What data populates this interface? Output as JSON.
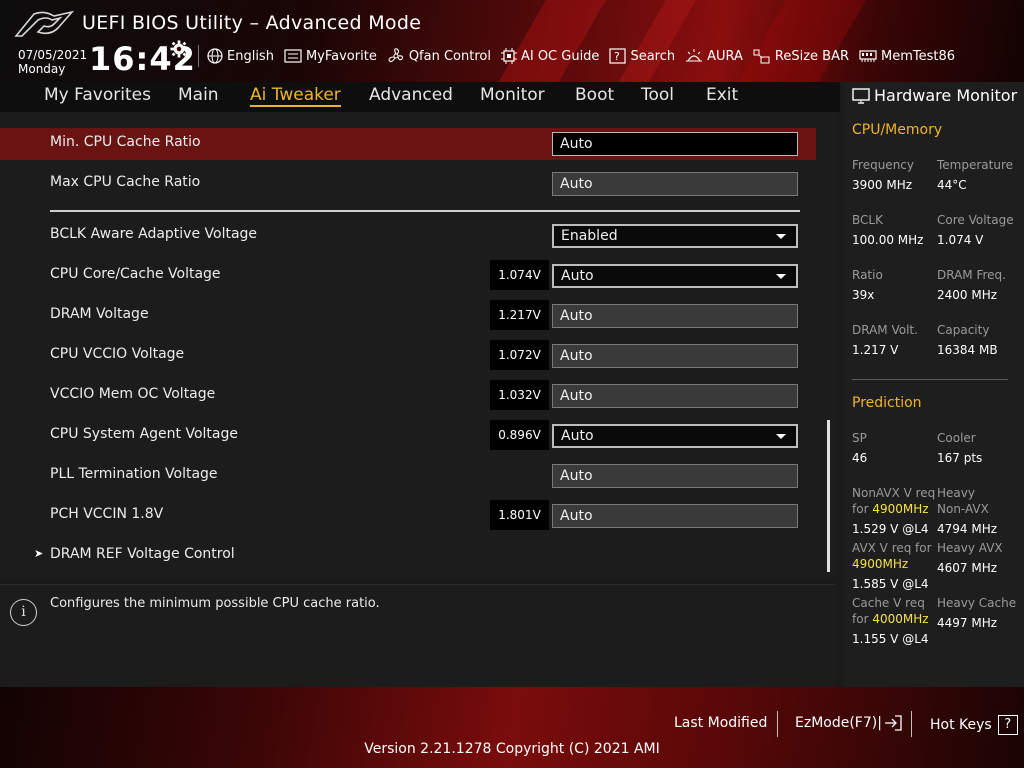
{
  "header": {
    "title": "UEFI BIOS Utility – Advanced Mode",
    "date": "07/05/2021",
    "day": "Monday",
    "time": "16:42",
    "toolbar": [
      {
        "label": "English",
        "icon": "globe-icon"
      },
      {
        "label": "MyFavorite",
        "icon": "favorite-icon"
      },
      {
        "label": "Qfan Control",
        "icon": "fan-icon"
      },
      {
        "label": "AI OC Guide",
        "icon": "ai-oc-icon"
      },
      {
        "label": "Search",
        "icon": "search-help-icon"
      },
      {
        "label": "AURA",
        "icon": "aura-icon"
      },
      {
        "label": "ReSize BAR",
        "icon": "resize-bar-icon"
      },
      {
        "label": "MemTest86",
        "icon": "memtest-icon"
      }
    ]
  },
  "menu": {
    "tabs": [
      "My Favorites",
      "Main",
      "Ai Tweaker",
      "Advanced",
      "Monitor",
      "Boot",
      "Tool",
      "Exit"
    ],
    "active": "Ai Tweaker"
  },
  "settings": [
    {
      "label": "Min. CPU Cache Ratio",
      "value": "Auto",
      "voltage": "",
      "selected": true,
      "dropdown": false
    },
    {
      "label": "Max CPU Cache Ratio",
      "value": "Auto",
      "voltage": "",
      "selected": false,
      "dropdown": false
    },
    {
      "label": "BCLK Aware Adaptive Voltage",
      "value": "Enabled",
      "voltage": "",
      "selected": false,
      "dropdown": true
    },
    {
      "label": "CPU Core/Cache Voltage",
      "value": "Auto",
      "voltage": "1.074V",
      "selected": false,
      "dropdown": true
    },
    {
      "label": "DRAM Voltage",
      "value": "Auto",
      "voltage": "1.217V",
      "selected": false,
      "dropdown": false
    },
    {
      "label": "CPU VCCIO Voltage",
      "value": "Auto",
      "voltage": "1.072V",
      "selected": false,
      "dropdown": false
    },
    {
      "label": "VCCIO Mem OC Voltage",
      "value": "Auto",
      "voltage": "1.032V",
      "selected": false,
      "dropdown": false
    },
    {
      "label": "CPU System Agent Voltage",
      "value": "Auto",
      "voltage": "0.896V",
      "selected": false,
      "dropdown": true
    },
    {
      "label": "PLL Termination Voltage",
      "value": "Auto",
      "voltage": "",
      "selected": false,
      "dropdown": false
    },
    {
      "label": "PCH VCCIN 1.8V",
      "value": "Auto",
      "voltage": "1.801V",
      "selected": false,
      "dropdown": false
    }
  ],
  "submenu": {
    "label": "DRAM REF Voltage Control",
    "arrow": "➤"
  },
  "help": {
    "text": "Configures the minimum possible CPU cache ratio.",
    "icon": "i"
  },
  "hw_monitor": {
    "title": "Hardware Monitor",
    "cpu_memory": {
      "heading": "CPU/Memory",
      "items": [
        {
          "label": "Frequency",
          "value": "3900 MHz"
        },
        {
          "label": "Temperature",
          "value": "44°C"
        },
        {
          "label": "BCLK",
          "value": "100.00 MHz"
        },
        {
          "label": "Core Voltage",
          "value": "1.074 V"
        },
        {
          "label": "Ratio",
          "value": "39x"
        },
        {
          "label": "DRAM Freq.",
          "value": "2400 MHz"
        },
        {
          "label": "DRAM Volt.",
          "value": "1.217 V"
        },
        {
          "label": "Capacity",
          "value": "16384 MB"
        }
      ]
    },
    "prediction": {
      "heading": "Prediction",
      "sp_label": "SP",
      "sp_value": "46",
      "cooler_label": "Cooler",
      "cooler_value": "167 pts",
      "nonavx_req_label": "NonAVX V req",
      "nonavx_for": "for",
      "nonavx_freq": "4900MHz",
      "nonavx_value": "1.529 V @L4",
      "heavy_nonavx_label_1": "Heavy",
      "heavy_nonavx_label_2": "Non-AVX",
      "heavy_nonavx_value": "4794 MHz",
      "avx_req_label": "AVX V req",
      "avx_for": "for",
      "avx_freq": "4900MHz",
      "avx_value": "1.585 V @L4",
      "heavy_avx_label": "Heavy AVX",
      "heavy_avx_value": "4607 MHz",
      "cache_req_label": "Cache V req",
      "cache_for": "for",
      "cache_freq": "4000MHz",
      "cache_value": "1.155 V @L4",
      "heavy_cache_label": "Heavy Cache",
      "heavy_cache_value": "4497 MHz"
    }
  },
  "footer": {
    "last_modified": "Last Modified",
    "ezmode": "EzMode(F7)|",
    "hotkeys": "Hot Keys",
    "hotkeys_key": "?",
    "version": "Version 2.21.1278 Copyright (C) 2021 AMI"
  },
  "colors": {
    "accent": "#f0b429",
    "selected_row": "#6a1313",
    "highlight_freq": "#f5e04a"
  }
}
